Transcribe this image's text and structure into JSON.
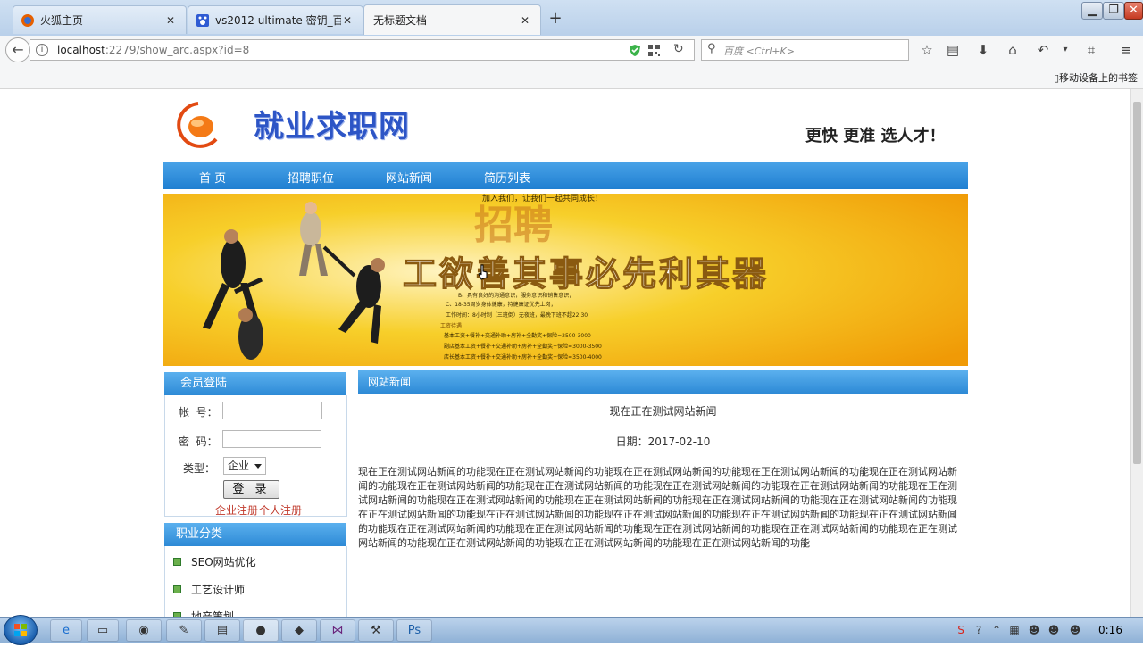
{
  "browser": {
    "tabs": [
      {
        "title": "火狐主页",
        "close": "✕",
        "active": false
      },
      {
        "title": "vs2012 ultimate 密钥_百...",
        "close": "✕",
        "active": false
      },
      {
        "title": "无标题文档",
        "close": "✕",
        "active": true
      }
    ],
    "new_tab": "+",
    "url_host": "localhost",
    "url_rest": ":2279/show_arc.aspx?id=8",
    "search_placeholder": "百度 <Ctrl+K>",
    "bookmarks_mobile": "移动设备上的书签"
  },
  "site": {
    "title": "就业求职网",
    "slogan": "更快 更准 选人才！",
    "nav": [
      "首 页",
      "招聘职位",
      "网站新闻",
      "简历列表"
    ],
    "banner": {
      "top_text": "加入我们，让我们一起共同成长！",
      "big_chars": "招聘",
      "headline": "工欲善其事必先利其器",
      "lines": [
        "B、具有良好的沟通意识，服务意识和销售意识；",
        "C、18-35周岁身体健康，持健康证优先上岗；",
        "工作时间：8小时制（三班倒）无夜班，最晚下班不超22:30",
        "工资待遇",
        "基本工资+餐补+交通补助+房补+全勤奖+保险=2500-3000",
        "副店基本工资+餐补+交通补助+房补+全勤奖+保险=3000-3500",
        "店长基本工资+餐补+交通补助+房补+全勤奖+保险=3500-4000"
      ]
    },
    "login": {
      "header": "会员登陆",
      "account_label": "帐  号：",
      "password_label": "密  码：",
      "type_label": "类型：",
      "type_value": "企业",
      "submit": "登 录",
      "link_company": "企业注册",
      "link_personal": "个人注册"
    },
    "categories": {
      "header": "职业分类",
      "items": [
        "SEO网站优化",
        "工艺设计师",
        "地产策划"
      ]
    },
    "news": {
      "header": "网站新闻",
      "title": "现在正在测试网站新闻",
      "date": "日期：2017-02-10",
      "body": "现在正在测试网站新闻的功能现在正在测试网站新闻的功能现在正在测试网站新闻的功能现在正在测试网站新闻的功能现在正在测试网站新闻的功能现在正在测试网站新闻的功能现在正在测试网站新闻的功能现在正在测试网站新闻的功能现在正在测试网站新闻的功能现在正在测试网站新闻的功能现在正在测试网站新闻的功能现在正在测试网站新闻的功能现在正在测试网站新闻的功能现在正在测试网站新闻的功能现在正在测试网站新闻的功能现在正在测试网站新闻的功能现在正在测试网站新闻的功能现在正在测试网站新闻的功能现在正在测试网站新闻的功能现在正在测试网站新闻的功能现在正在测试网站新闻的功能现在正在测试网站新闻的功能现在正在测试网站新闻的功能现在正在测试网站新闻的功能现在正在测试网站新闻的功能现在正在测试网站新闻的功能现在正在测试网站新闻的功能"
    }
  },
  "taskbar": {
    "clock": "0:16"
  },
  "colors": {
    "nav_blue": "#2d8ad6",
    "title_blue": "#2d55c6",
    "link_red": "#c0392b",
    "banner_yellow": "#f5c400"
  }
}
